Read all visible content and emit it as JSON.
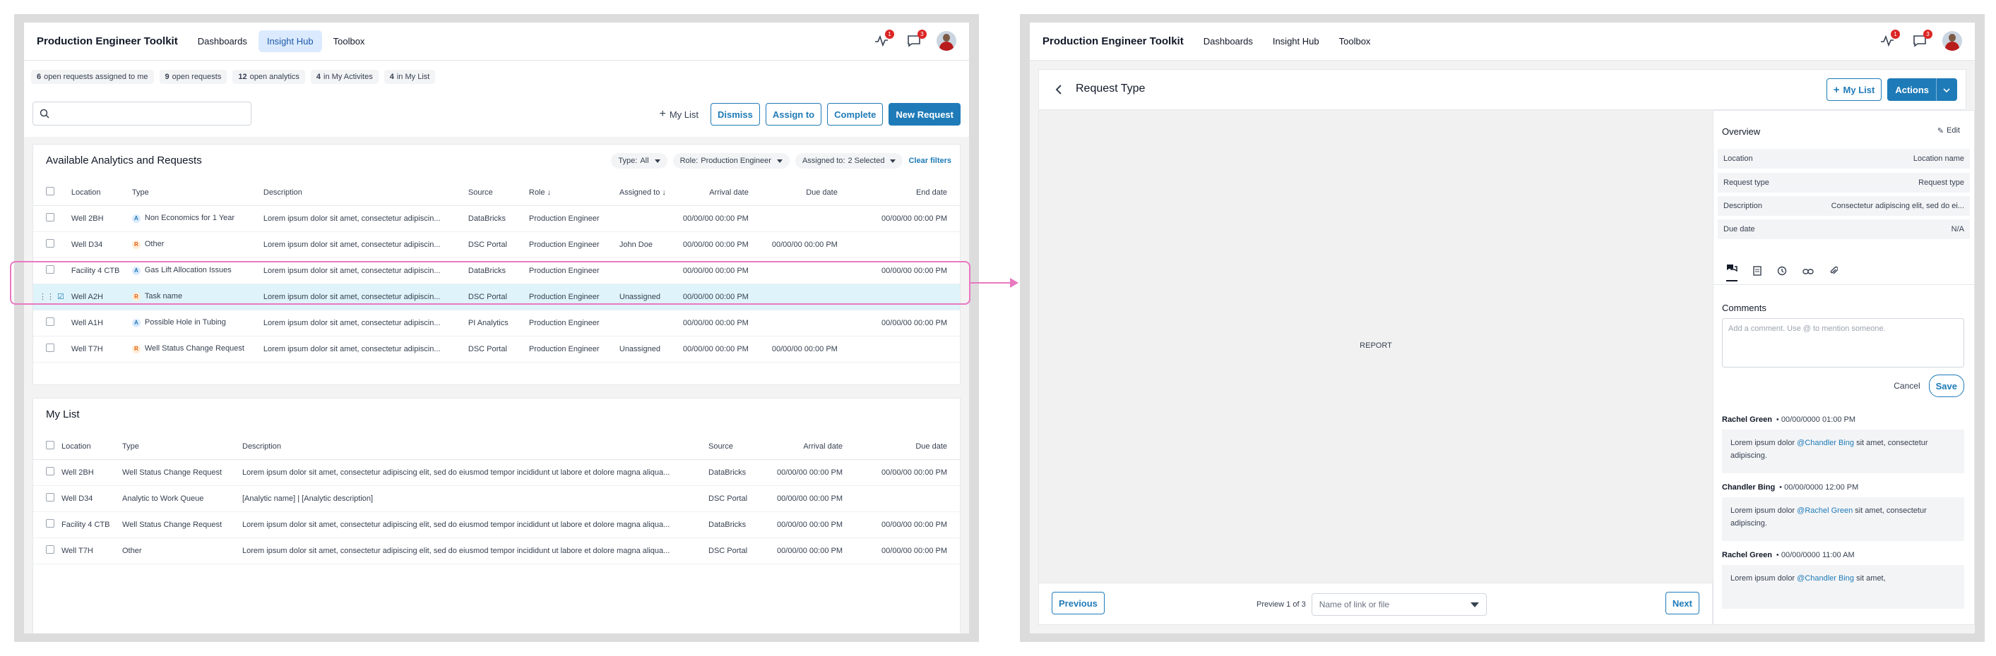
{
  "app": {
    "title": "Production Engineer Toolkit",
    "nav": [
      "Dashboards",
      "Insight Hub",
      "Toolbox"
    ],
    "active_nav": "Insight Hub",
    "badges": {
      "activity": "1",
      "messages": "3"
    }
  },
  "left": {
    "chips": [
      {
        "count": "6",
        "label": "open requests assigned to me"
      },
      {
        "count": "9",
        "label": "open requests"
      },
      {
        "count": "12",
        "label": "open analytics"
      },
      {
        "count": "4",
        "label": "in My Activites"
      },
      {
        "count": "4",
        "label": "in My List"
      }
    ],
    "search_placeholder": "",
    "actions": {
      "my_list": "My List",
      "dismiss": "Dismiss",
      "assign": "Assign to",
      "complete": "Complete",
      "new": "New Request"
    },
    "available": {
      "title": "Available Analytics and Requests",
      "filters": {
        "type_label": "Type:",
        "type_value": "All",
        "role_label": "Role:",
        "role_value": "Production Engineer",
        "assigned_label": "Assigned to:",
        "assigned_value": "2 Selected",
        "clear": "Clear filters"
      },
      "headers": [
        "Location",
        "Type",
        "Description",
        "Source",
        "Role",
        "Assigned to",
        "Arrival date",
        "Due date",
        "End date"
      ],
      "rows": [
        {
          "loc": "Well 2BH",
          "tag": "A",
          "type": "Non Economics for 1 Year",
          "desc": "Lorem ipsum dolor sit amet, consectetur adipiscin...",
          "src": "DataBricks",
          "role": "Production Engineer",
          "assigned": "",
          "arrival": "00/00/00 00:00 PM",
          "due": "",
          "end": "00/00/00 00:00 PM"
        },
        {
          "loc": "Well D34",
          "tag": "R",
          "type": "Other",
          "desc": "Lorem ipsum dolor sit amet, consectetur adipiscin...",
          "src": "DSC Portal",
          "role": "Production Engineer",
          "assigned": "John Doe",
          "arrival": "00/00/00 00:00 PM",
          "due": "00/00/00 00:00 PM",
          "end": ""
        },
        {
          "loc": "Facility 4 CTB",
          "tag": "A",
          "type": "Gas Lift Allocation Issues",
          "desc": "Lorem ipsum dolor sit amet, consectetur adipiscin...",
          "src": "DataBricks",
          "role": "Production Engineer",
          "assigned": "",
          "arrival": "00/00/00 00:00 PM",
          "due": "",
          "end": "00/00/00 00:00 PM"
        },
        {
          "loc": "Well A2H",
          "tag": "R",
          "type": "Task name",
          "desc": "Lorem ipsum dolor sit amet, consectetur adipiscin...",
          "src": "DSC Portal",
          "role": "Production Engineer",
          "assigned": "Unassigned",
          "arrival": "00/00/00 00:00 PM",
          "due": "",
          "end": ""
        },
        {
          "loc": "Well A1H",
          "tag": "A",
          "type": "Possible Hole in Tubing",
          "desc": "Lorem ipsum dolor sit amet, consectetur adipiscin...",
          "src": "PI Analytics",
          "role": "Production Engineer",
          "assigned": "",
          "arrival": "00/00/00 00:00 PM",
          "due": "",
          "end": "00/00/00 00:00 PM"
        },
        {
          "loc": "Well T7H",
          "tag": "R",
          "type": "Well Status Change Request",
          "desc": "Lorem ipsum dolor sit amet, consectetur adipiscin...",
          "src": "DSC Portal",
          "role": "Production Engineer",
          "assigned": "Unassigned",
          "arrival": "00/00/00 00:00 PM",
          "due": "00/00/00 00:00 PM",
          "end": ""
        }
      ]
    },
    "mylist": {
      "title": "My List",
      "headers": [
        "Location",
        "Type",
        "Description",
        "Source",
        "Arrival date",
        "Due date"
      ],
      "rows": [
        {
          "loc": "Well 2BH",
          "type": "Well Status Change Request",
          "desc": "Lorem ipsum dolor sit amet, consectetur adipiscing elit, sed do eiusmod tempor incididunt ut labore et dolore magna aliqua...",
          "src": "DataBricks",
          "arrival": "00/00/00 00:00 PM",
          "due": "00/00/00 00:00 PM"
        },
        {
          "loc": "Well D34",
          "type": "Analytic to Work Queue",
          "desc": "[Analytic name] | [Analytic description]",
          "src": "DSC Portal",
          "arrival": "00/00/00 00:00 PM",
          "due": ""
        },
        {
          "loc": "Facility 4 CTB",
          "type": "Well Status Change Request",
          "desc": "Lorem ipsum dolor sit amet, consectetur adipiscing elit, sed do eiusmod tempor incididunt ut labore et dolore magna aliqua...",
          "src": "DataBricks",
          "arrival": "00/00/00 00:00 PM",
          "due": "00/00/00 00:00 PM"
        },
        {
          "loc": "Well T7H",
          "type": "Other",
          "desc": "Lorem ipsum dolor sit amet, consectetur adipiscing elit, sed do eiusmod tempor incididunt ut labore et dolore magna aliqua...",
          "src": "DSC Portal",
          "arrival": "00/00/00 00:00 PM",
          "due": "00/00/00 00:00 PM"
        }
      ]
    }
  },
  "right": {
    "title": "Request Type",
    "my_list": "My List",
    "actions": "Actions",
    "report": "REPORT",
    "previous": "Previous",
    "next": "Next",
    "preview": "Preview 1 of 3",
    "link_placeholder": "Name of link or file",
    "overview": {
      "title": "Overview",
      "edit": "Edit",
      "fields": [
        {
          "k": "Location",
          "v": "Location name"
        },
        {
          "k": "Request type",
          "v": "Request type"
        },
        {
          "k": "Description",
          "v": "Consectetur adipiscing elit, sed do ei..."
        },
        {
          "k": "Due date",
          "v": "N/A"
        }
      ]
    },
    "comments": {
      "title": "Comments",
      "placeholder": "Add a comment. Use @ to mention someone.",
      "cancel": "Cancel",
      "save": "Save",
      "items": [
        {
          "author": "Rachel Green",
          "time": "00/00/0000 01:00 PM",
          "pre": "Lorem ipsum dolor ",
          "mention": "@Chandler Bing",
          "post": " sit amet, consectetur adipiscing."
        },
        {
          "author": "Chandler Bing",
          "time": "00/00/0000 12:00 PM",
          "pre": "Lorem ipsum dolor ",
          "mention": "@Rachel Green",
          "post": " sit amet, consectetur adipiscing."
        },
        {
          "author": "Rachel Green",
          "time": "00/00/0000 11:00 AM",
          "pre": "Lorem ipsum dolor ",
          "mention": "@Chandler Bing",
          "post": " sit amet,"
        }
      ]
    }
  }
}
